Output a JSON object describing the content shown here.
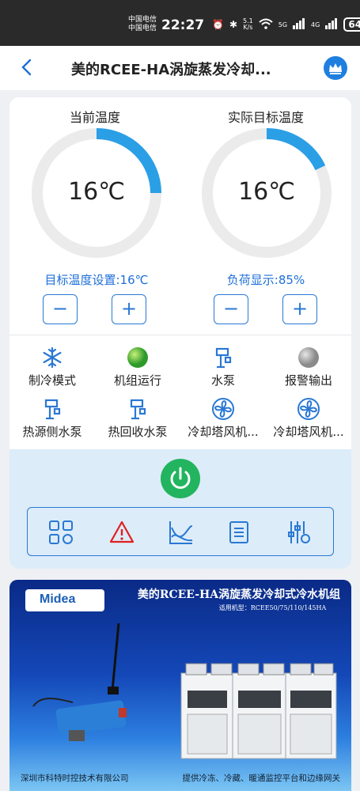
{
  "status_bar": {
    "carrier_line1": "中国电信",
    "carrier_line2": "中国电信",
    "time": "22:27",
    "net_speed_value": "5.1",
    "net_speed_unit": "K/s",
    "signal_a": "5G",
    "signal_b": "4G",
    "battery": "64"
  },
  "app_bar": {
    "title": "美的RCEE-HA涡旋蒸发冷却..."
  },
  "gauges": [
    {
      "label": "当前温度",
      "value": "16℃",
      "fraction": 0.25
    },
    {
      "label": "实际目标温度",
      "value": "16℃",
      "fraction": 0.18
    }
  ],
  "setpoints": {
    "target_label": "目标温度设置:16℃",
    "load_label": "负荷显示:85%"
  },
  "stepper": {
    "minus": "−",
    "plus": "+"
  },
  "status_items": [
    {
      "label": "制冷模式",
      "icon": "snowflake-icon"
    },
    {
      "label": "机组运行",
      "icon": "running-indicator-icon"
    },
    {
      "label": "水泵",
      "icon": "pump-icon"
    },
    {
      "label": "报警输出",
      "icon": "alarm-indicator-icon"
    },
    {
      "label": "热源侧水泵",
      "icon": "pump-icon"
    },
    {
      "label": "热回收水泵",
      "icon": "pump-icon"
    },
    {
      "label": "冷却塔风机...",
      "icon": "fan-icon"
    },
    {
      "label": "冷却塔风机...",
      "icon": "fan-icon"
    }
  ],
  "toolbar_icons": [
    "grid-icon",
    "warning-icon",
    "trend-chart-icon",
    "list-icon",
    "sliders-icon"
  ],
  "colors": {
    "accent": "#1e6fd9",
    "gauge_track": "#ebebeb",
    "gauge_fill": "#2a9fe6",
    "power": "#22b45f",
    "run_green": "#3bb03a",
    "alarm_gray": "#a0a0a0",
    "alert_red": "#e02020"
  },
  "banner": {
    "logo": "Midea",
    "title": "美的RCEE-HA涡旋蒸发冷却式冷水机组",
    "models": "适用机型：RCEE50/75/110/145HA",
    "footer_left": "深圳市科特时控技术有限公司",
    "footer_right": "提供冷冻、冷藏、暖通监控平台和边缘网关"
  }
}
